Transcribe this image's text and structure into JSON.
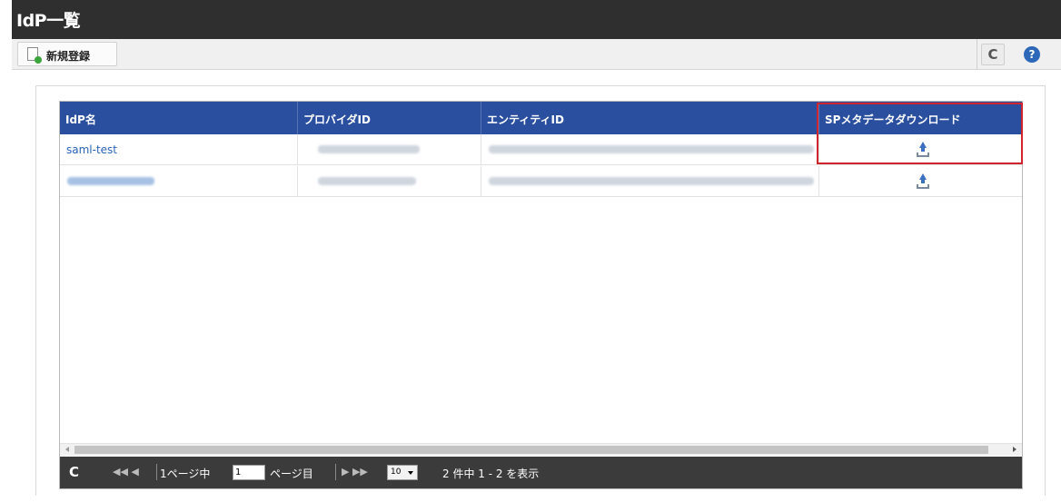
{
  "window": {
    "title": "IdP一覧"
  },
  "toolbar": {
    "new_label": "新規登録",
    "refresh_symbol": "C",
    "help_symbol": "?"
  },
  "grid": {
    "columns": [
      "IdP名",
      "プロバイダID",
      "エンティティID",
      "SPメタデータダウンロード"
    ],
    "rows": [
      {
        "name": "saml-test"
      },
      {
        "name": ""
      }
    ]
  },
  "pager": {
    "refresh_symbol": "C",
    "first_prev": "◀◀ ◀",
    "page_prefix": "1ページ中",
    "current_page": "1",
    "page_suffix": "ページ目",
    "next_last": "▶ ▶▶",
    "page_size": "10",
    "summary": "2 件中 1 - 2 を表示"
  },
  "colors": {
    "titlebar": "#2f2f2f",
    "header": "#2a4f9f",
    "link": "#2a63b7",
    "highlight": "#d0242e",
    "pager": "#3b3b3b"
  },
  "icons": [
    "new-document-icon",
    "refresh-icon",
    "help-icon",
    "download-icon"
  ]
}
